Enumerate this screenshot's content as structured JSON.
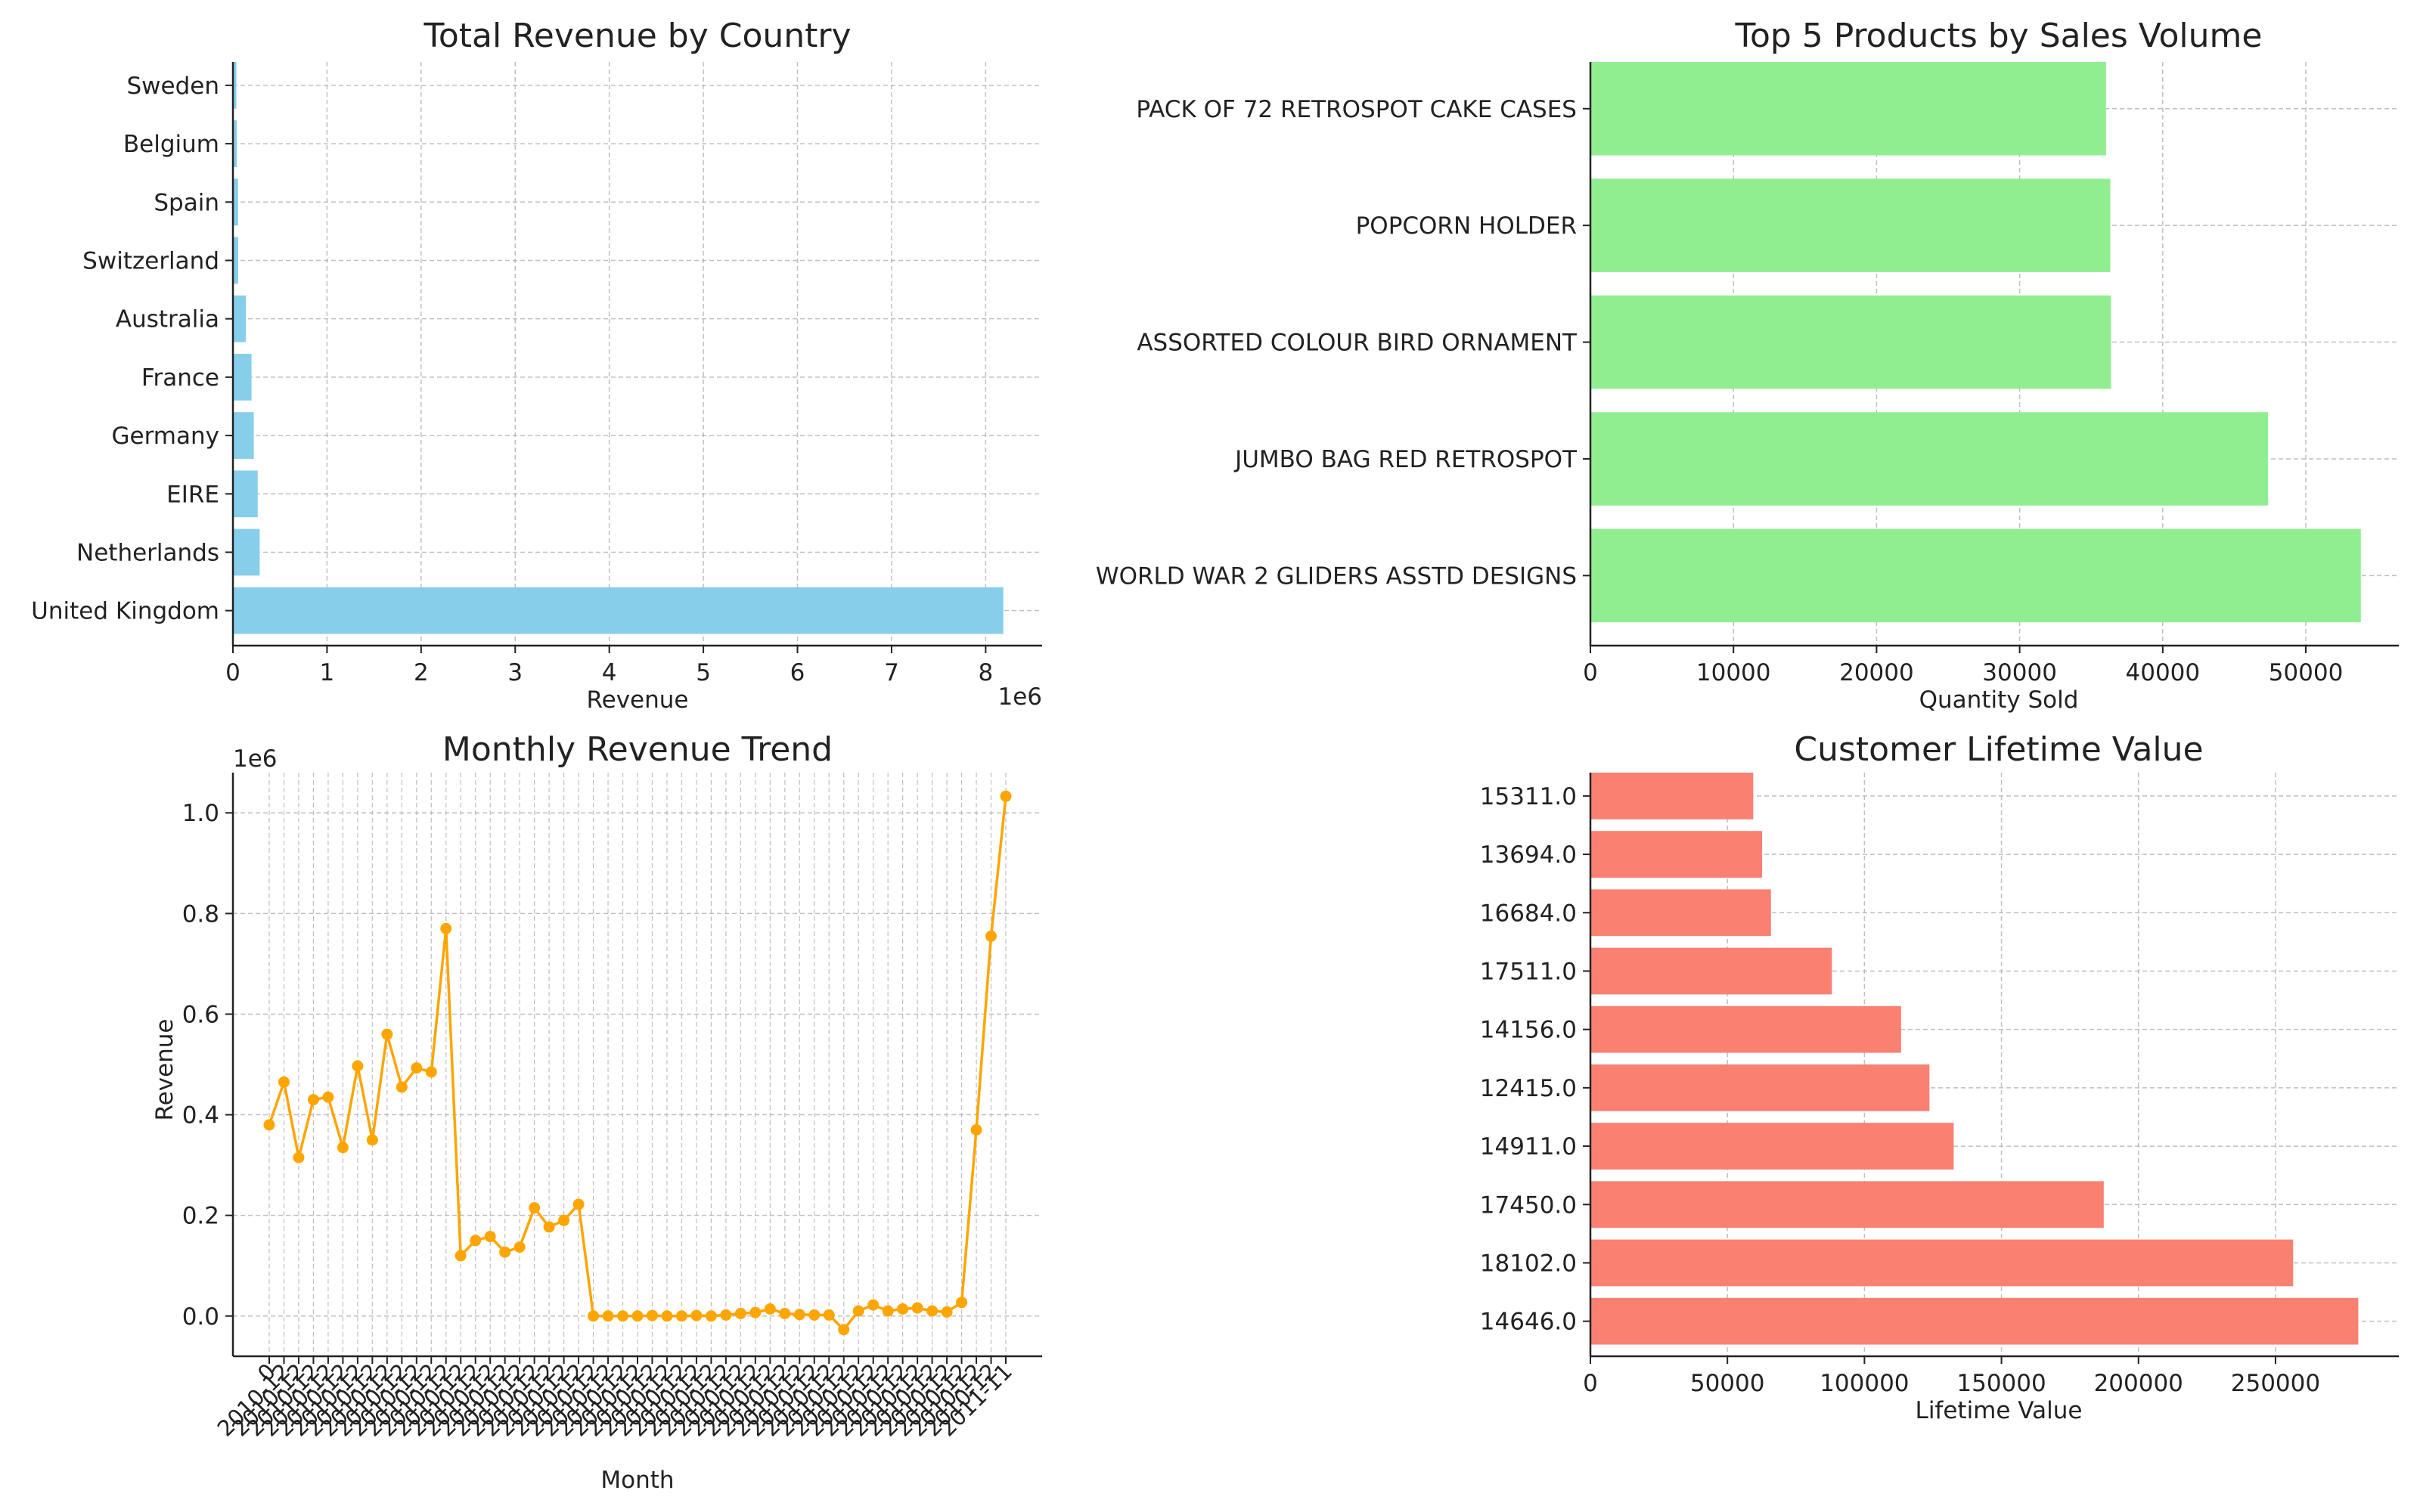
{
  "colors": {
    "country": "#87CEEB",
    "products": "#90EE90",
    "monthly": "#FFA500",
    "clv": "#FA8072",
    "grid": "#b0b0b0",
    "axis": "#222222"
  },
  "chart_data": [
    {
      "id": "country",
      "type": "bar",
      "orientation": "horizontal",
      "title": "Total Revenue by Country",
      "xlabel": "Revenue",
      "ylabel": "",
      "x_offset_label": "1e6",
      "categories": [
        "United Kingdom",
        "Netherlands",
        "EIRE",
        "Germany",
        "France",
        "Australia",
        "Switzerland",
        "Spain",
        "Belgium",
        "Sweden"
      ],
      "values": [
        8187806,
        284661,
        263276,
        221698,
        197404,
        137077,
        56385,
        54775,
        40911,
        36595
      ],
      "xlim": [
        0,
        8600000
      ],
      "xticks": [
        0,
        1000000,
        2000000,
        3000000,
        4000000,
        5000000,
        6000000,
        7000000,
        8000000
      ],
      "xtick_labels": [
        "0",
        "1",
        "2",
        "3",
        "4",
        "5",
        "6",
        "7",
        "8"
      ],
      "grid": true
    },
    {
      "id": "products",
      "type": "bar",
      "orientation": "horizontal",
      "title": "Top 5 Products by Sales Volume",
      "xlabel": "Quantity Sold",
      "ylabel": "",
      "categories": [
        "WORLD WAR 2 GLIDERS ASSTD DESIGNS",
        "JUMBO BAG RED RETROSPOT",
        "ASSORTED COLOUR BIRD ORNAMENT",
        "POPCORN HOLDER",
        "PACK OF 72 RETROSPOT CAKE CASES"
      ],
      "values": [
        53847,
        47363,
        36381,
        36334,
        36039
      ],
      "xlim": [
        0,
        56500
      ],
      "xticks": [
        0,
        10000,
        20000,
        30000,
        40000,
        50000
      ],
      "xtick_labels": [
        "0",
        "10000",
        "20000",
        "30000",
        "40000",
        "50000"
      ],
      "grid": true
    },
    {
      "id": "monthly",
      "type": "line",
      "title": "Monthly Revenue Trend",
      "xlabel": "Month",
      "ylabel": "Revenue",
      "y_offset_label": "1e6",
      "x_tick_label_sample": [
        "0",
        "2010-12",
        "2011-11"
      ],
      "values": [
        380000,
        465000,
        315000,
        430000,
        435000,
        335000,
        497000,
        350000,
        560000,
        455000,
        493000,
        485000,
        770000,
        120000,
        150000,
        158000,
        127000,
        137000,
        215000,
        177000,
        190000,
        222000,
        0,
        0,
        0,
        0,
        1000,
        0,
        0,
        1000,
        0,
        2000,
        5000,
        7000,
        14000,
        5000,
        3000,
        2000,
        2000,
        -27000,
        10000,
        22000,
        10000,
        14000,
        16000,
        10000,
        8000,
        27000,
        370000,
        755000,
        1033000
      ],
      "ylim": [
        -80000,
        1080000
      ],
      "yticks": [
        0,
        200000,
        400000,
        600000,
        800000,
        1000000
      ],
      "ytick_labels": [
        "0.0",
        "0.2",
        "0.4",
        "0.6",
        "0.8",
        "1.0"
      ],
      "grid": true
    },
    {
      "id": "clv",
      "type": "bar",
      "orientation": "horizontal",
      "title": "Customer Lifetime Value",
      "xlabel": "Lifetime Value",
      "ylabel": "",
      "categories": [
        "14646.0",
        "18102.0",
        "17450.0",
        "14911.0",
        "12415.0",
        "14156.0",
        "17511.0",
        "16684.0",
        "13694.0",
        "15311.0"
      ],
      "values": [
        280206,
        256438,
        187322,
        132573,
        123725,
        113385,
        88125,
        65892,
        62653,
        59419
      ],
      "xlim": [
        0,
        295000
      ],
      "xticks": [
        0,
        50000,
        100000,
        150000,
        200000,
        250000
      ],
      "xtick_labels": [
        "0",
        "50000",
        "100000",
        "150000",
        "200000",
        "250000"
      ],
      "grid": true
    }
  ]
}
